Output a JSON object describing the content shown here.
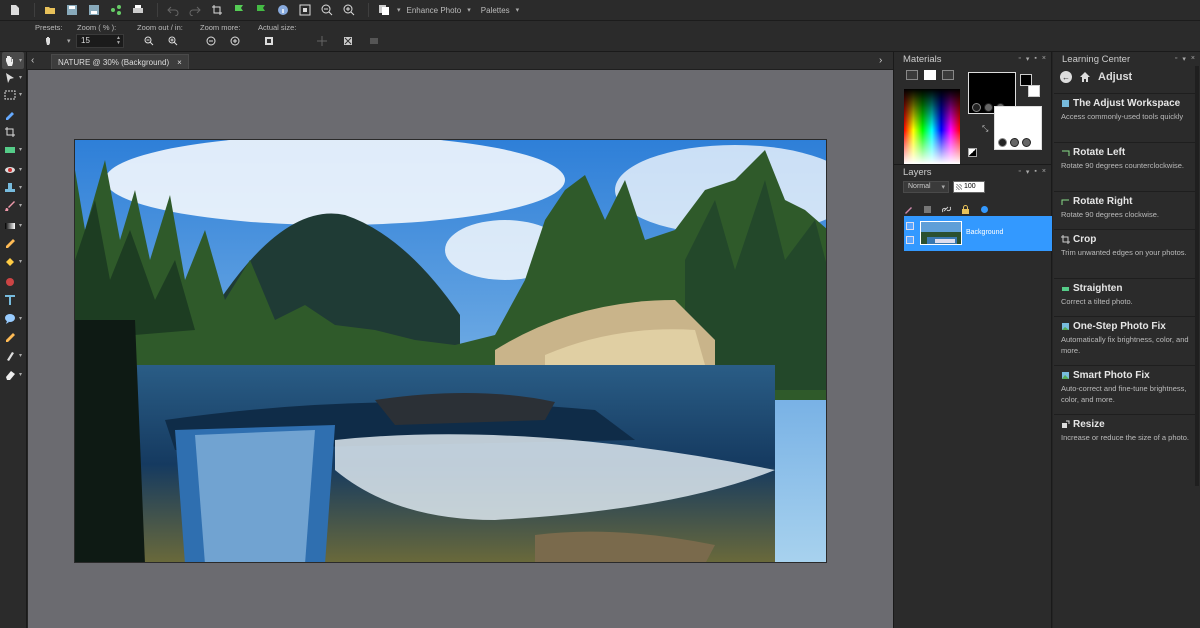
{
  "topbar": {
    "enhance_label": "Enhance Photo",
    "palettes_label": "Palettes"
  },
  "options": {
    "presets_label": "Presets:",
    "zoom_label": "Zoom ( % ):",
    "zoom_value": "15",
    "zoom_out_in_label": "Zoom out / in:",
    "zoom_more_label": "Zoom more:",
    "actual_size_label": "Actual size:"
  },
  "document": {
    "tab_title": "NATURE @ 30% (Background)"
  },
  "materials": {
    "title": "Materials"
  },
  "layers": {
    "title": "Layers",
    "blend_mode": "Normal",
    "opacity": "100",
    "layer_name": "Background"
  },
  "learning": {
    "title": "Learning Center",
    "section": "Adjust",
    "items": [
      {
        "title": "The Adjust Workspace",
        "desc": "Access commonly-used tools quickly"
      },
      {
        "title": "Rotate Left",
        "desc": "Rotate 90 degrees counterclockwise."
      },
      {
        "title": "Rotate Right",
        "desc": "Rotate 90 degrees clockwise."
      },
      {
        "title": "Crop",
        "desc": "Trim unwanted edges on your photos."
      },
      {
        "title": "Straighten",
        "desc": "Correct a tilted photo."
      },
      {
        "title": "One-Step Photo Fix",
        "desc": "Automatically fix brightness, color, and more."
      },
      {
        "title": "Smart Photo Fix",
        "desc": "Auto-correct and fine-tune brightness, color, and more."
      },
      {
        "title": "Resize",
        "desc": "Increase or reduce the size of a photo."
      }
    ]
  },
  "colors": {
    "selection_blue": "#3399ff",
    "workspace_gray": "#6b6b70",
    "panel_bg": "#2b2b2b"
  }
}
